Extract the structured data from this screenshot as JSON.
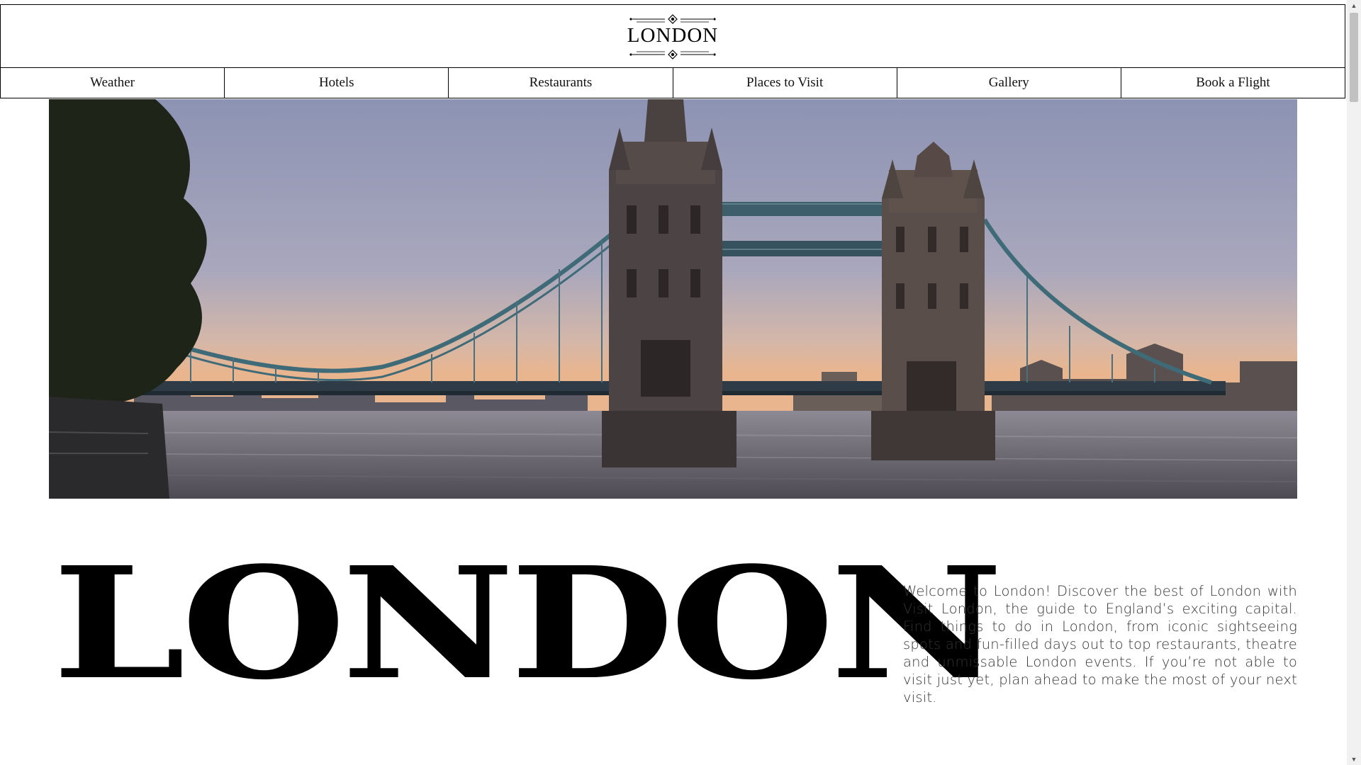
{
  "header": {
    "logo_text": "LONDON"
  },
  "nav": {
    "items": [
      {
        "label": "Weather"
      },
      {
        "label": "Hotels"
      },
      {
        "label": "Restaurants"
      },
      {
        "label": "Places to Visit"
      },
      {
        "label": "Gallery"
      },
      {
        "label": "Book a Flight"
      }
    ]
  },
  "hero": {
    "image_subject": "tower-bridge-at-dusk"
  },
  "intro": {
    "title": "LONDON",
    "text": "Welcome to London! Discover the best of London with Visit London, the guide to England’s exciting capital. Find things to do in London, from iconic sightseeing spots and fun-filled days out to top restaurants, theatre and unmissable London events. If you’re not able to visit just yet, plan ahead to make the most of your next visit."
  },
  "colors": {
    "text": "#000000",
    "body_text": "#333333",
    "border": "#000000",
    "background": "#ffffff"
  }
}
